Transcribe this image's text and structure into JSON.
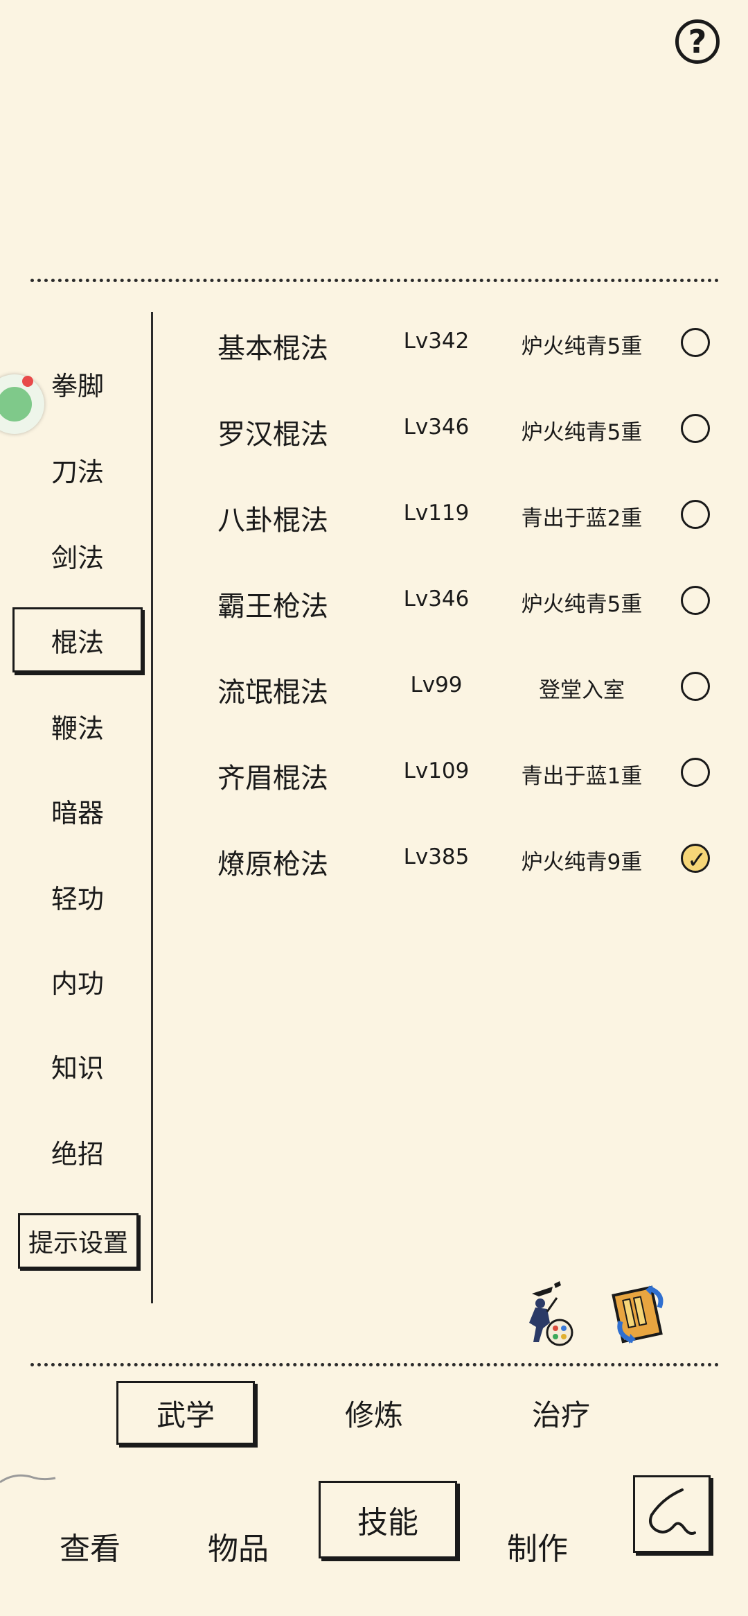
{
  "help_icon": "question-mark-icon",
  "categories": [
    {
      "label": "拳脚",
      "selected": false
    },
    {
      "label": "刀法",
      "selected": false
    },
    {
      "label": "剑法",
      "selected": false
    },
    {
      "label": "棍法",
      "selected": true
    },
    {
      "label": "鞭法",
      "selected": false
    },
    {
      "label": "暗器",
      "selected": false
    },
    {
      "label": "轻功",
      "selected": false
    },
    {
      "label": "内功",
      "selected": false
    },
    {
      "label": "知识",
      "selected": false
    },
    {
      "label": "绝招",
      "selected": false
    }
  ],
  "tip_settings_label": "提示设置",
  "skills": [
    {
      "name": "基本棍法",
      "level": "Lv342",
      "grade": "炉火纯青5重",
      "checked": false
    },
    {
      "name": "罗汉棍法",
      "level": "Lv346",
      "grade": "炉火纯青5重",
      "checked": false
    },
    {
      "name": "八卦棍法",
      "level": "Lv119",
      "grade": "青出于蓝2重",
      "checked": false
    },
    {
      "name": "霸王枪法",
      "level": "Lv346",
      "grade": "炉火纯青5重",
      "checked": false
    },
    {
      "name": "流氓棍法",
      "level": "Lv99",
      "grade": "登堂入室",
      "checked": false
    },
    {
      "name": "齐眉棍法",
      "level": "Lv109",
      "grade": "青出于蓝1重",
      "checked": false
    },
    {
      "name": "燎原枪法",
      "level": "Lv385",
      "grade": "炉火纯青9重",
      "checked": true
    }
  ],
  "sub_tabs": [
    {
      "label": "武学",
      "selected": true
    },
    {
      "label": "修炼",
      "selected": false
    },
    {
      "label": "治疗",
      "selected": false
    }
  ],
  "bottom_tabs": [
    {
      "label": "查看",
      "selected": false
    },
    {
      "label": "物品",
      "selected": false
    },
    {
      "label": "技能",
      "selected": true
    },
    {
      "label": "制作",
      "selected": false
    }
  ],
  "colors": {
    "background": "#fbf4e2",
    "ink": "#1a1a1a",
    "checked_fill": "#f6d678"
  }
}
